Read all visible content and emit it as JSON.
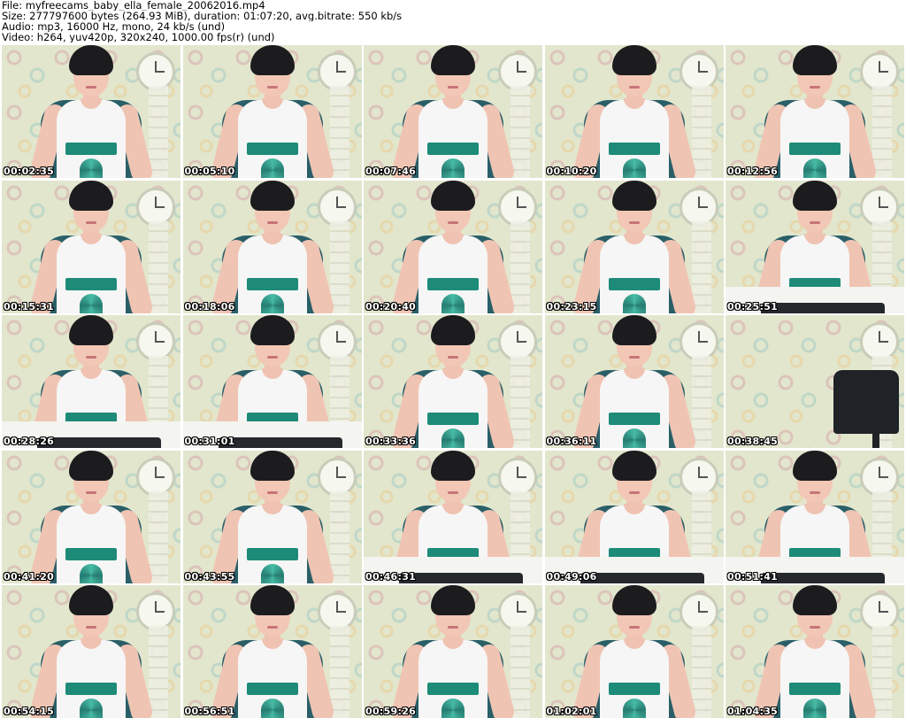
{
  "header": {
    "line1": "File: myfreecams_baby_ella_female_20062016.mp4",
    "line2": "Size: 277797600 bytes (264.93 MiB), duration: 01:07:20, avg.bitrate: 550 kb/s",
    "line3": "Audio: mp3, 16000 Hz, mono, 24 kb/s (und)",
    "line4": "Video: h264, yuv420p, 320x240, 1000.00 fps(r) (und)"
  },
  "thumbnails": [
    {
      "timestamp": "00:02:35"
    },
    {
      "timestamp": "00:05:10"
    },
    {
      "timestamp": "00:07:46"
    },
    {
      "timestamp": "00:10:20"
    },
    {
      "timestamp": "00:12:56"
    },
    {
      "timestamp": "00:15:31"
    },
    {
      "timestamp": "00:18:06"
    },
    {
      "timestamp": "00:20:40"
    },
    {
      "timestamp": "00:23:15"
    },
    {
      "timestamp": "00:25:51"
    },
    {
      "timestamp": "00:28:26"
    },
    {
      "timestamp": "00:31:01"
    },
    {
      "timestamp": "00:33:36"
    },
    {
      "timestamp": "00:36:11"
    },
    {
      "timestamp": "00:38:45"
    },
    {
      "timestamp": "00:41:20"
    },
    {
      "timestamp": "00:43:55"
    },
    {
      "timestamp": "00:46:31"
    },
    {
      "timestamp": "00:49:06"
    },
    {
      "timestamp": "00:51:41"
    },
    {
      "timestamp": "00:54:15"
    },
    {
      "timestamp": "00:56:51"
    },
    {
      "timestamp": "00:59:26"
    },
    {
      "timestamp": "01:02:01"
    },
    {
      "timestamp": "01:04:35"
    }
  ]
}
